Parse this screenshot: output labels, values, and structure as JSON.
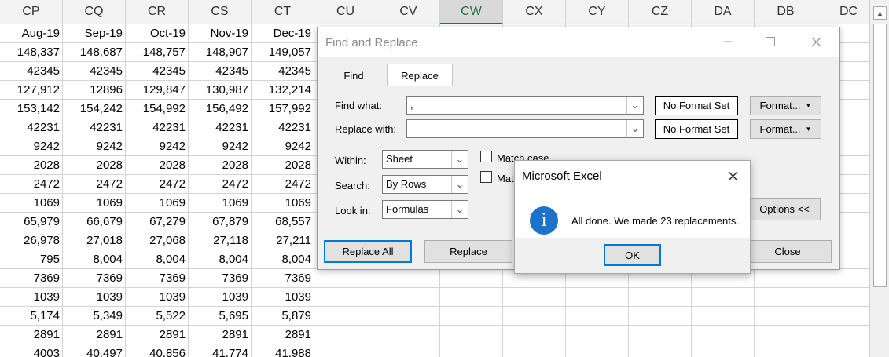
{
  "sheet": {
    "columns": [
      "CP",
      "CQ",
      "CR",
      "CS",
      "CT",
      "CU",
      "CV",
      "CW",
      "CX",
      "CY",
      "CZ",
      "DA",
      "DB",
      "DC"
    ],
    "active_column": "CW",
    "rows": [
      [
        "Aug-19",
        "Sep-19",
        "Oct-19",
        "Nov-19",
        "Dec-19"
      ],
      [
        "148,337",
        "148,687",
        "148,757",
        "148,907",
        "149,057"
      ],
      [
        "42345",
        "42345",
        "42345",
        "42345",
        "42345"
      ],
      [
        "127,912",
        "12896",
        "129,847",
        "130,987",
        "132,214"
      ],
      [
        "153,142",
        "154,242",
        "154,992",
        "156,492",
        "157,992"
      ],
      [
        "42231",
        "42231",
        "42231",
        "42231",
        "42231"
      ],
      [
        "9242",
        "9242",
        "9242",
        "9242",
        "9242"
      ],
      [
        "2028",
        "2028",
        "2028",
        "2028",
        "2028"
      ],
      [
        "2472",
        "2472",
        "2472",
        "2472",
        "2472"
      ],
      [
        "1069",
        "1069",
        "1069",
        "1069",
        "1069"
      ],
      [
        "65,979",
        "66,679",
        "67,279",
        "67,879",
        "68,557"
      ],
      [
        "26,978",
        "27,018",
        "27,068",
        "27,118",
        "27,211"
      ],
      [
        "795",
        "8,004",
        "8,004",
        "8,004",
        "8,004"
      ],
      [
        "7369",
        "7369",
        "7369",
        "7369",
        "7369"
      ],
      [
        "1039",
        "1039",
        "1039",
        "1039",
        "1039"
      ],
      [
        "5,174",
        "5,349",
        "5,522",
        "5,695",
        "5,879"
      ],
      [
        "2891",
        "2891",
        "2891",
        "2891",
        "2891"
      ],
      [
        "4003",
        "40,497",
        "40,856",
        "41,774",
        "41,988"
      ]
    ]
  },
  "find_replace": {
    "title": "Find and Replace",
    "tabs": {
      "find": "Find",
      "replace": "Replace"
    },
    "find_what_label": "Find what:",
    "find_what_value": ",",
    "replace_with_label": "Replace with:",
    "replace_with_value": "",
    "no_format_set": "No Format Set",
    "format_button": "Format...",
    "within_label": "Within:",
    "within_value": "Sheet",
    "search_label": "Search:",
    "search_value": "By Rows",
    "look_in_label": "Look in:",
    "look_in_value": "Formulas",
    "match_case_label": "Match case",
    "match_entire_label": "Mat",
    "options_button": "Options <<",
    "replace_all_button": "Replace All",
    "replace_button": "Replace",
    "close_button": "Close"
  },
  "message_box": {
    "title": "Microsoft Excel",
    "message": "All done. We made 23 replacements.",
    "ok_button": "OK",
    "icon": "information-icon"
  }
}
